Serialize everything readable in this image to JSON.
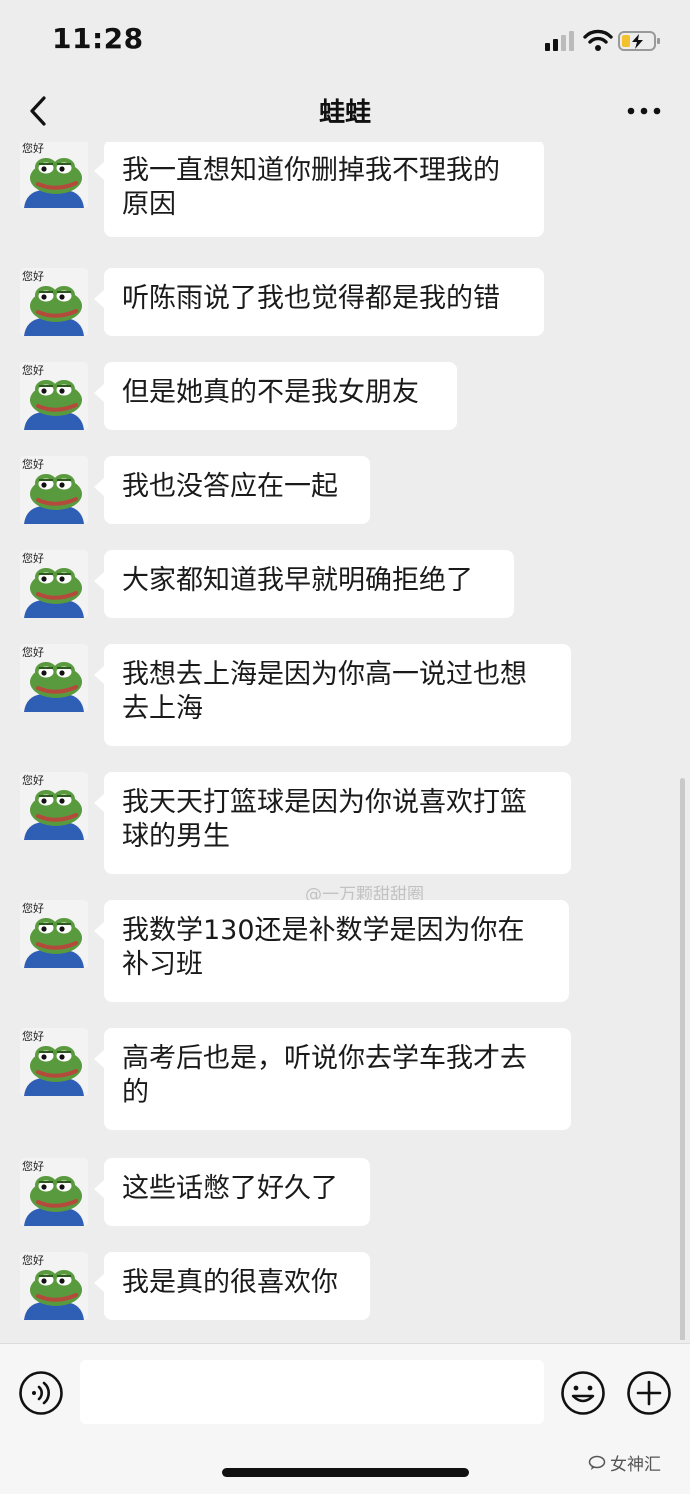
{
  "status_bar": {
    "time": "11:28"
  },
  "nav": {
    "title": "蛙蛙"
  },
  "avatar_caption": "您好",
  "messages": [
    {
      "text": "我一直想知道你删掉我不理我的原因"
    },
    {
      "text": "听陈雨说了我也觉得都是我的错"
    },
    {
      "text": "但是她真的不是我女朋友"
    },
    {
      "text": "我也没答应在一起"
    },
    {
      "text": "大家都知道我早就明确拒绝了"
    },
    {
      "text": "我想去上海是因为你高一说过也想去上海"
    },
    {
      "text": "我天天打篮球是因为你说喜欢打篮球的男生"
    },
    {
      "text": "我数学130还是补数学是因为你在补习班"
    },
    {
      "text": "高考后也是，听说你去学车我才去的"
    },
    {
      "text": "这些话憋了好久了"
    },
    {
      "text": "我是真的很喜欢你"
    }
  ],
  "watermark": "@一万颗甜甜圈",
  "input": {
    "value": ""
  },
  "brand": "女神汇",
  "colors": {
    "background": "#ededed",
    "bubble": "#ffffff",
    "pepe_green": "#5a9a3f",
    "pepe_shirt": "#2f5fb5"
  },
  "icons": [
    "back-chevron-icon",
    "more-dots-icon",
    "voice-icon",
    "emoji-icon",
    "plus-icon",
    "signal-icon",
    "wifi-icon",
    "battery-charging-icon"
  ]
}
